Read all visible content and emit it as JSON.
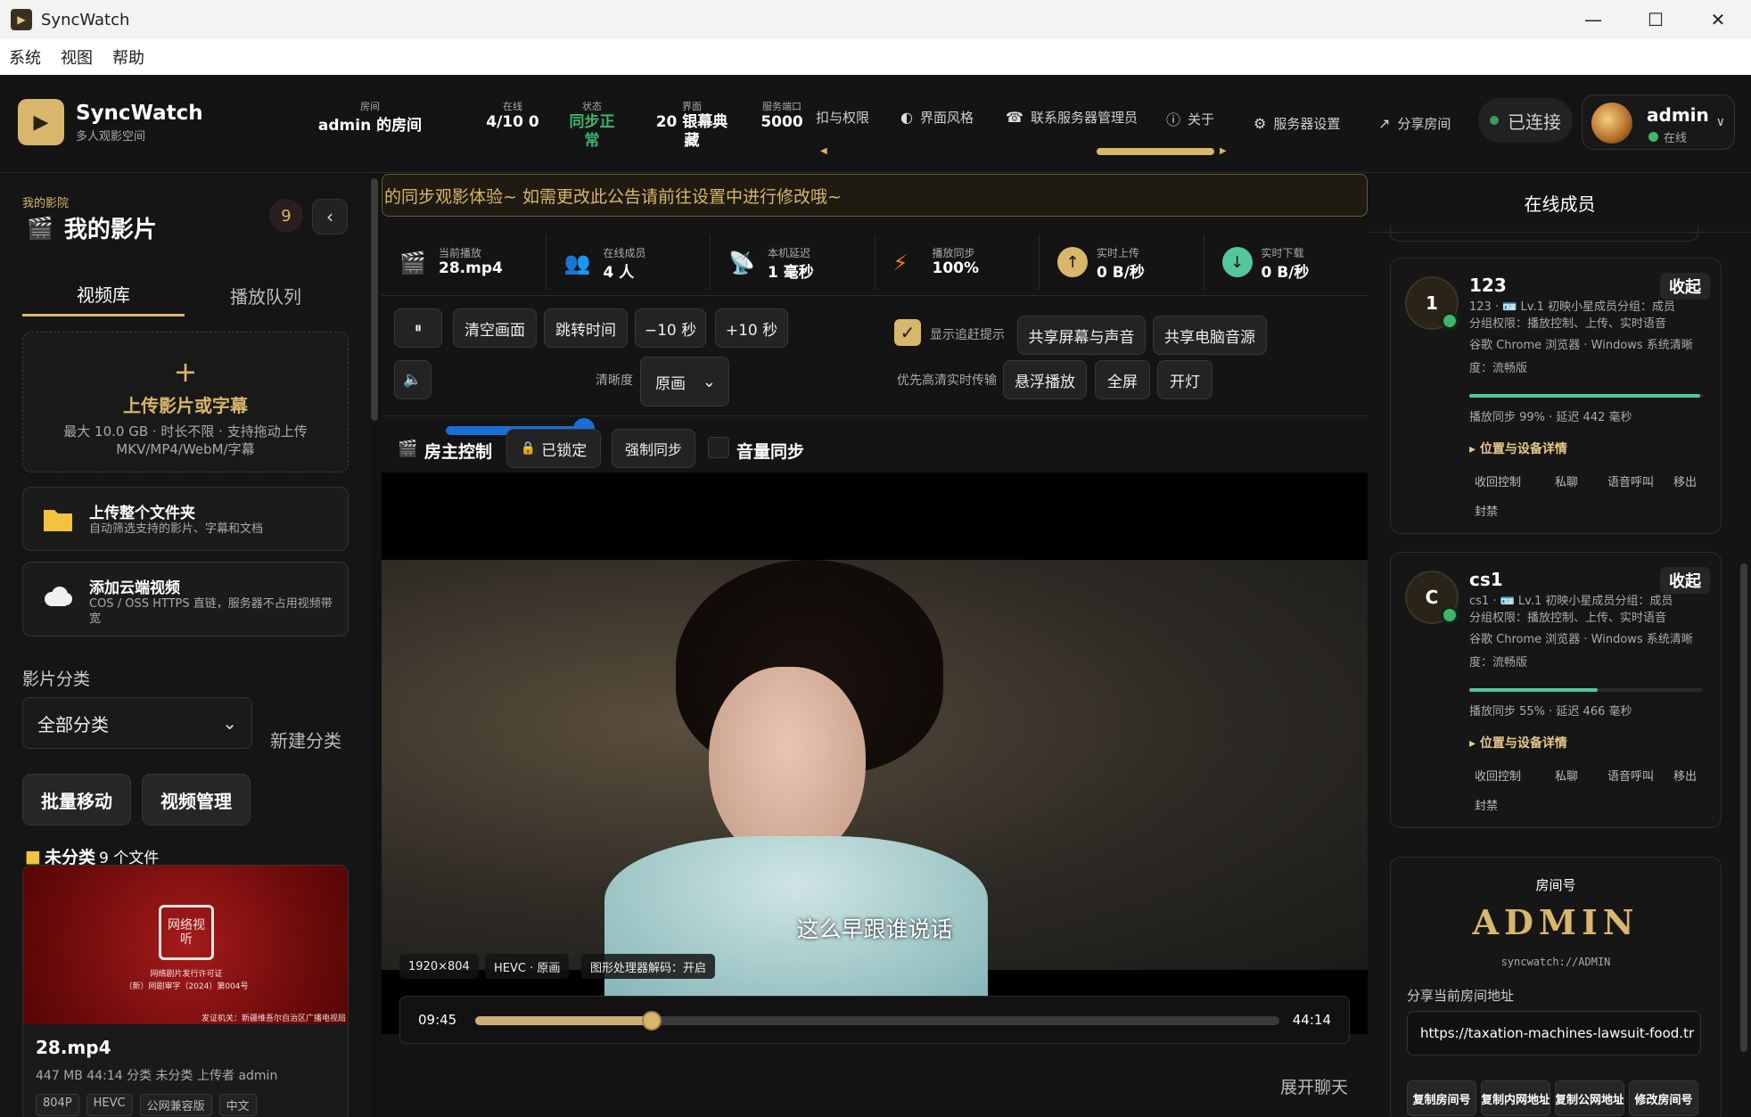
{
  "window": {
    "title": "SyncWatch",
    "minimize": "—",
    "maximize": "☐",
    "close": "✕"
  },
  "menu": [
    "系统",
    "视图",
    "帮助"
  ],
  "header": {
    "brand": "SyncWatch",
    "brand_sub": "多人观影空间",
    "room_label": "房间",
    "room_value": "admin 的房间",
    "online_label": "在线",
    "online_value": "4/10 0",
    "status_label": "状态",
    "status_value": "同步正常",
    "ui_label": "界面",
    "ui_value": "20 银幕典藏",
    "port_label": "服务端口",
    "port_value": "5000",
    "nav_perm": "扣与权限",
    "nav_theme": "界面风格",
    "nav_contact": "联系服务器管理员",
    "nav_about": "关于",
    "nav_server": "服务器设置",
    "nav_share": "分享房间",
    "connected": "已连接",
    "user_name": "admin",
    "user_status": "在线"
  },
  "left": {
    "sub": "我的影院",
    "title": "我的影片",
    "badge": "9",
    "tab_library": "视频库",
    "tab_queue": "播放队列",
    "upload_plus": "+",
    "upload_title": "上传影片或字幕",
    "upload_desc": "最大 10.0 GB · 时长不限 · 支持拖动上传 MKV/MP4/WebM/字幕",
    "folder_title": "上传整个文件夹",
    "folder_desc": "自动筛选支持的影片、字幕和文档",
    "cloud_title": "添加云端视频",
    "cloud_desc": "COS / OSS HTTPS 直链，服务器不占用视频带宽",
    "category_label": "影片分类",
    "category_value": "全部分类",
    "new_category": "新建分类",
    "batch_move": "批量移动",
    "video_manage": "视频管理",
    "folder_name": "未分类",
    "folder_count": "9 个文件",
    "movie": {
      "name": "28.mp4",
      "meta": "447 MB  44:14  分类 未分类  上传者 admin",
      "tags": [
        "804P",
        "HEVC",
        "公网兼容版",
        "中文"
      ],
      "seal": "网络视听",
      "license1": "网络剧片发行许可证",
      "license2": "（新）网剧审字（2024）第004号",
      "license3": "发证机关：新疆维吾尔自治区广播电视局"
    }
  },
  "center": {
    "announcement": "的同步观影体验~ 如需更改此公告请前往设置中进行修改哦~",
    "stats": [
      {
        "label": "当前播放",
        "value": "28.mp4",
        "icon": "clapper-icon"
      },
      {
        "label": "在线成员",
        "value": "4 人",
        "icon": "users-icon"
      },
      {
        "label": "本机延迟",
        "value": "1 毫秒",
        "icon": "satellite-icon"
      },
      {
        "label": "播放同步",
        "value": "100%",
        "icon": "bolt-icon"
      },
      {
        "label": "实时上传",
        "value": "0 B/秒",
        "icon": "upload-icon"
      },
      {
        "label": "实时下载",
        "value": "0 B/秒",
        "icon": "download-icon"
      }
    ],
    "btn_pause": "⏸",
    "btn_clear": "清空画面",
    "btn_jump": "跳转时间",
    "btn_back10": "−10 秒",
    "btn_fwd10": "+10 秒",
    "chase_hint": "显示追赶提示",
    "share_screen": "共享屏幕与声音",
    "share_audio": "共享电脑音源",
    "clarity_label": "清晰度",
    "clarity_value": "原画",
    "hd_hint": "优先高清实时传输",
    "float_play": "悬浮播放",
    "fullscreen": "全屏",
    "light": "开灯",
    "volume": 0.8,
    "host_control": "房主控制",
    "locked": "已锁定",
    "force_sync": "强制同步",
    "volume_sync": "音量同步",
    "subtitle": "这么早跟谁说话",
    "badge_res": "1920×804",
    "badge_codec": "HEVC · 原画",
    "badge_gpu": "图形处理器解码：开启",
    "time_current": "09:45",
    "time_total": "44:14",
    "progress": 0.22,
    "expand_chat": "展开聊天"
  },
  "right": {
    "title": "在线成员",
    "members": [
      {
        "avatar": "1",
        "name": "123",
        "collapse": "收起",
        "line1": "123 · 🪪 Lv.1 初映小星成员分组：成员",
        "line2": "分组权限：播放控制、上传、实时语音",
        "line3": "谷歌 Chrome 浏览器 · Windows 系统清晰",
        "line4": "度：流畅版",
        "sync": 0.99,
        "sync_text": "播放同步 99% · 延迟 442 毫秒",
        "details": "▸ 位置与设备详情",
        "actions": [
          "收回控制",
          "私聊",
          "语音呼叫",
          "移出",
          "封禁"
        ]
      },
      {
        "avatar": "C",
        "name": "cs1",
        "collapse": "收起",
        "line1": "cs1 · 🪪 Lv.1 初映小星成员分组：成员",
        "line2": "分组权限：播放控制、上传、实时语音",
        "line3": "谷歌 Chrome 浏览器 · Windows 系统清晰",
        "line4": "度：流畅版",
        "sync": 0.55,
        "sync_text": "播放同步 55% · 延迟 466 毫秒",
        "details": "▸ 位置与设备详情",
        "actions": [
          "收回控制",
          "私聊",
          "语音呼叫",
          "移出",
          "封禁"
        ]
      }
    ],
    "room_label": "房间号",
    "room_id": "ADMIN",
    "room_url": "syncwatch://ADMIN",
    "share_label": "分享当前房间地址",
    "share_url": "https://taxation-machines-lawsuit-food.tr",
    "btn_copy_room": "复制房间号",
    "btn_copy_lan": "复制内网地址",
    "btn_copy_public": "复制公网地址",
    "btn_modify": "修改房间号"
  },
  "colors": {
    "accent": "#d8b66b",
    "online": "#3db56a",
    "volume": "#1a6fd6",
    "bg": "#141414"
  }
}
